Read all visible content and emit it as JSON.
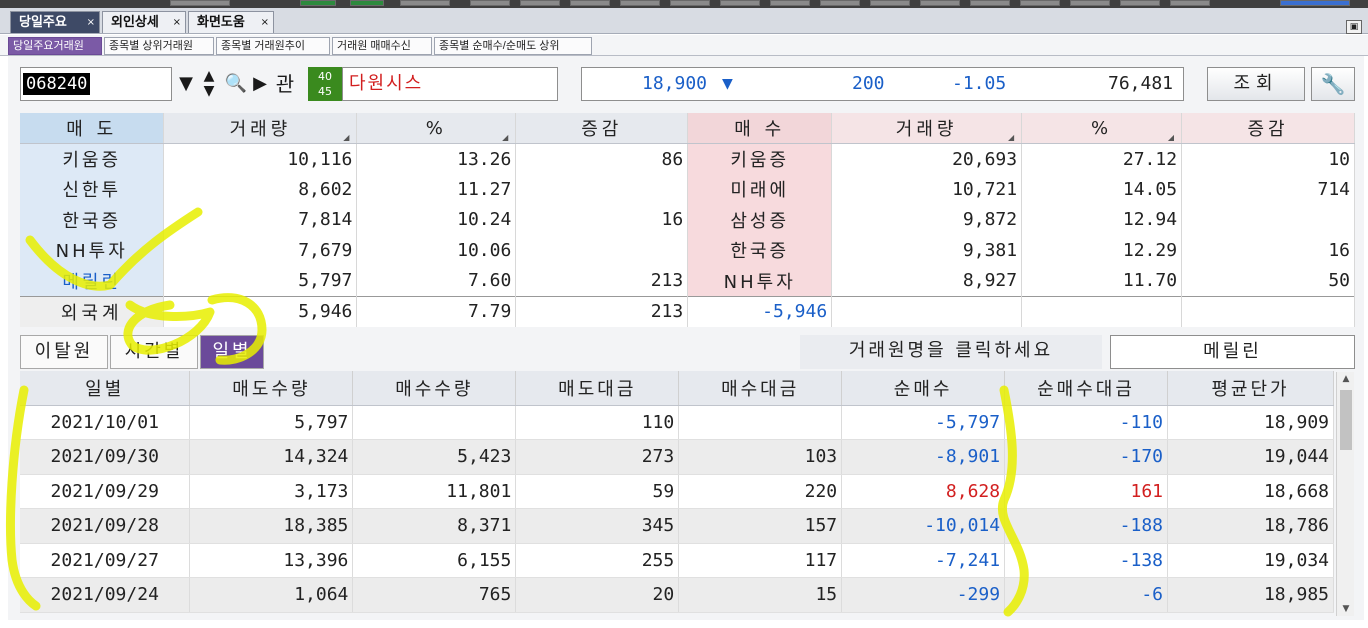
{
  "window_tabs": [
    {
      "label": "당일주요",
      "close": "×"
    },
    {
      "label": "외인상세",
      "close": "×"
    },
    {
      "label": "화면도움",
      "close": "×"
    }
  ],
  "sub_tabs": [
    "당일주요거래원",
    "종목별 상위거래원",
    "종목별 거래원추이",
    "거래원 매매수신",
    "종목별 순매수/순매도 상위"
  ],
  "stock": {
    "code": "068240",
    "market_badge": "40\n45",
    "name": "다원시스",
    "price": "18,900",
    "change": "200",
    "change_pct": "-1.05",
    "volume": "76,481",
    "query_label": "조회",
    "icon_colors": {
      "name": "#d21f1f",
      "price": "#1a5fc8",
      "badge": "#3a8a1e"
    }
  },
  "ranking": {
    "headers": [
      "매 도",
      "거래량",
      "%",
      "증감",
      "매 수",
      "거래량",
      "%",
      "증감"
    ],
    "rows": [
      {
        "sell_name": "키움증",
        "sell_vol": "10,116",
        "sell_pct": "13.26",
        "sell_chg": "86",
        "buy_name": "키움증",
        "buy_vol": "20,693",
        "buy_pct": "27.12",
        "buy_chg": "10"
      },
      {
        "sell_name": "신한투",
        "sell_vol": "8,602",
        "sell_pct": "11.27",
        "sell_chg": "",
        "buy_name": "미래에",
        "buy_vol": "10,721",
        "buy_pct": "14.05",
        "buy_chg": "714"
      },
      {
        "sell_name": "한국증",
        "sell_vol": "7,814",
        "sell_pct": "10.24",
        "sell_chg": "16",
        "buy_name": "삼성증",
        "buy_vol": "9,872",
        "buy_pct": "12.94",
        "buy_chg": ""
      },
      {
        "sell_name": "NH투자",
        "sell_vol": "7,679",
        "sell_pct": "10.06",
        "sell_chg": "",
        "buy_name": "한국증",
        "buy_vol": "9,381",
        "buy_pct": "12.29",
        "buy_chg": "16"
      },
      {
        "sell_name": "메릴린",
        "sell_vol": "5,797",
        "sell_pct": "7.60",
        "sell_chg": "213",
        "buy_name": "NH투자",
        "buy_vol": "8,927",
        "buy_pct": "11.70",
        "buy_chg": "50"
      }
    ],
    "total": {
      "label": "외국계",
      "vol": "5,946",
      "pct": "7.79",
      "chg": "213",
      "net": "-5,946"
    }
  },
  "view_tabs": [
    "이탈원",
    "시간별",
    "일별"
  ],
  "hint_text": "거래원명을 클릭하세요",
  "selected_firm": "메릴린",
  "daily": {
    "headers": [
      "일별",
      "매도수량",
      "매수수량",
      "매도대금",
      "매수대금",
      "순매수",
      "순매수대금",
      "평균단가"
    ],
    "rows": [
      {
        "date": "2021/10/01",
        "sell_qty": "5,797",
        "buy_qty": "",
        "sell_amt": "110",
        "buy_amt": "",
        "net_qty": "-5,797",
        "net_amt": "-110",
        "avg": "18,909",
        "sign": "neg"
      },
      {
        "date": "2021/09/30",
        "sell_qty": "14,324",
        "buy_qty": "5,423",
        "sell_amt": "273",
        "buy_amt": "103",
        "net_qty": "-8,901",
        "net_amt": "-170",
        "avg": "19,044",
        "sign": "neg"
      },
      {
        "date": "2021/09/29",
        "sell_qty": "3,173",
        "buy_qty": "11,801",
        "sell_amt": "59",
        "buy_amt": "220",
        "net_qty": "8,628",
        "net_amt": "161",
        "avg": "18,668",
        "sign": "pos"
      },
      {
        "date": "2021/09/28",
        "sell_qty": "18,385",
        "buy_qty": "8,371",
        "sell_amt": "345",
        "buy_amt": "157",
        "net_qty": "-10,014",
        "net_amt": "-188",
        "avg": "18,786",
        "sign": "neg"
      },
      {
        "date": "2021/09/27",
        "sell_qty": "13,396",
        "buy_qty": "6,155",
        "sell_amt": "255",
        "buy_amt": "117",
        "net_qty": "-7,241",
        "net_amt": "-138",
        "avg": "19,034",
        "sign": "neg"
      },
      {
        "date": "2021/09/24",
        "sell_qty": "1,064",
        "buy_qty": "765",
        "sell_amt": "20",
        "buy_amt": "15",
        "net_qty": "-299",
        "net_amt": "-6",
        "avg": "18,985",
        "sign": "neg"
      }
    ]
  },
  "annotation_color": "#e8ef00"
}
